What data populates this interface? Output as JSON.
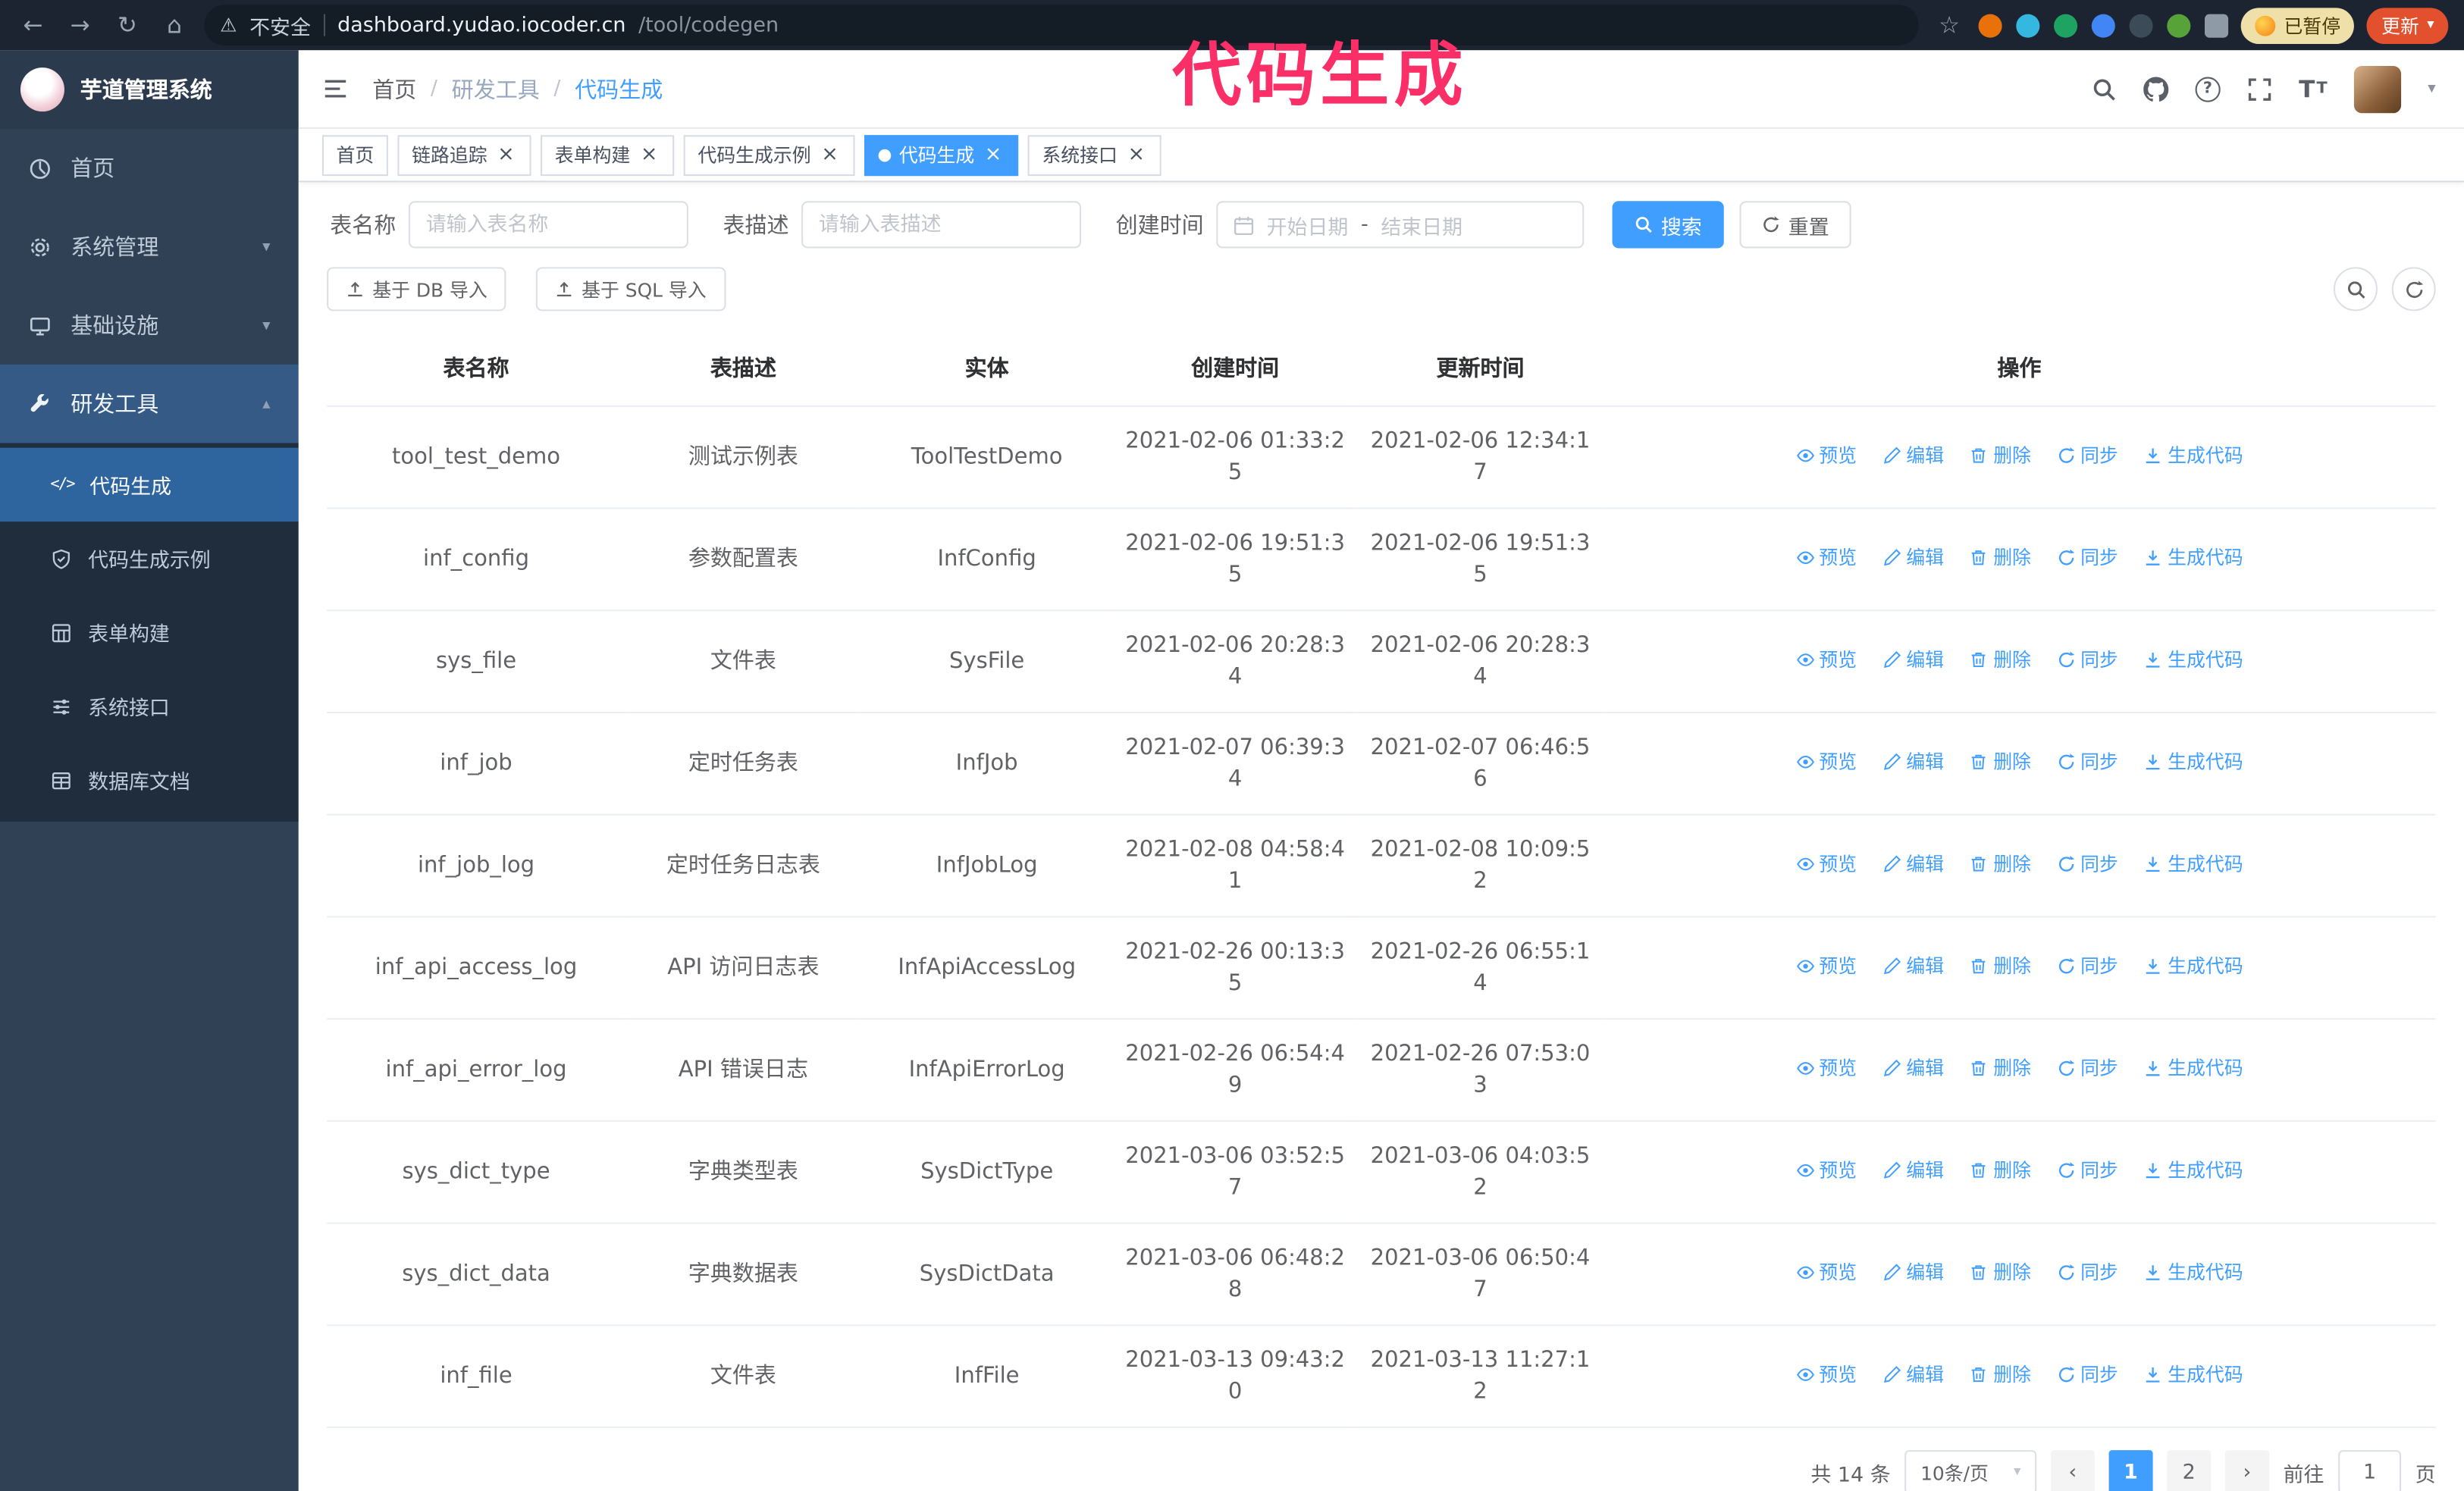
{
  "browser": {
    "security_label": "不安全",
    "url_host": "dashboard.yudao.iocoder.cn",
    "url_path": "/tool/codegen",
    "paused_badge": "已暂停",
    "update_button": "更新"
  },
  "annotation": {
    "text": "代码生成",
    "color": "#fb2f67"
  },
  "sidebar": {
    "logo_title": "芋道管理系统",
    "items": [
      "首页",
      "系统管理",
      "基础设施",
      "研发工具"
    ],
    "submenu": [
      "代码生成",
      "代码生成示例",
      "表单构建",
      "系统接口",
      "数据库文档"
    ]
  },
  "breadcrumb": {
    "items": [
      "首页",
      "研发工具",
      "代码生成"
    ],
    "separator": "/"
  },
  "tabs": [
    "首页",
    "链路追踪",
    "表单构建",
    "代码生成示例",
    "代码生成",
    "系统接口"
  ],
  "filters": {
    "name_label": "表名称",
    "name_placeholder": "请输入表名称",
    "desc_label": "表描述",
    "desc_placeholder": "请输入表描述",
    "time_label": "创建时间",
    "start_placeholder": "开始日期",
    "range_separator": "-",
    "end_placeholder": "结束日期",
    "search": "搜索",
    "reset": "重置"
  },
  "toolbar": {
    "import_db": "基于 DB 导入",
    "import_sql": "基于 SQL 导入"
  },
  "table": {
    "columns": [
      "表名称",
      "表描述",
      "实体",
      "创建时间",
      "更新时间",
      "操作"
    ],
    "row_actions": [
      "预览",
      "编辑",
      "删除",
      "同步",
      "生成代码"
    ],
    "rows": [
      {
        "name": "tool_test_demo",
        "desc": "测试示例表",
        "entity": "ToolTestDemo",
        "created": "2021-02-06 01:33:25",
        "updated": "2021-02-06 12:34:17"
      },
      {
        "name": "inf_config",
        "desc": "参数配置表",
        "entity": "InfConfig",
        "created": "2021-02-06 19:51:35",
        "updated": "2021-02-06 19:51:35"
      },
      {
        "name": "sys_file",
        "desc": "文件表",
        "entity": "SysFile",
        "created": "2021-02-06 20:28:34",
        "updated": "2021-02-06 20:28:34"
      },
      {
        "name": "inf_job",
        "desc": "定时任务表",
        "entity": "InfJob",
        "created": "2021-02-07 06:39:34",
        "updated": "2021-02-07 06:46:56"
      },
      {
        "name": "inf_job_log",
        "desc": "定时任务日志表",
        "entity": "InfJobLog",
        "created": "2021-02-08 04:58:41",
        "updated": "2021-02-08 10:09:52"
      },
      {
        "name": "inf_api_access_log",
        "desc": "API 访问日志表",
        "entity": "InfApiAccessLog",
        "created": "2021-02-26 00:13:35",
        "updated": "2021-02-26 06:55:14"
      },
      {
        "name": "inf_api_error_log",
        "desc": "API 错误日志",
        "entity": "InfApiErrorLog",
        "created": "2021-02-26 06:54:49",
        "updated": "2021-02-26 07:53:03"
      },
      {
        "name": "sys_dict_type",
        "desc": "字典类型表",
        "entity": "SysDictType",
        "created": "2021-03-06 03:52:57",
        "updated": "2021-03-06 04:03:52"
      },
      {
        "name": "sys_dict_data",
        "desc": "字典数据表",
        "entity": "SysDictData",
        "created": "2021-03-06 06:48:28",
        "updated": "2021-03-06 06:50:47"
      },
      {
        "name": "inf_file",
        "desc": "文件表",
        "entity": "InfFile",
        "created": "2021-03-13 09:43:20",
        "updated": "2021-03-13 11:27:12"
      }
    ]
  },
  "pagination": {
    "total": "共 14 条",
    "page_size": "10条/页",
    "pages": [
      "1",
      "2"
    ],
    "goto_label": "前往",
    "goto_value": "1",
    "goto_unit": "页"
  },
  "icons": {
    "back": "←",
    "forward": "→",
    "reload": "↻",
    "home": "⌂",
    "warning": "⚠",
    "star": "☆",
    "caret_down": "▾",
    "caret_up": "▴",
    "close": "×",
    "question": "?",
    "font_size": "T",
    "code": "</>",
    "prev": "‹",
    "next": "›"
  },
  "colors": {
    "accent": "#409eff",
    "sidebar_bg": "#304156",
    "submenu_bg": "#1f2d3d"
  }
}
